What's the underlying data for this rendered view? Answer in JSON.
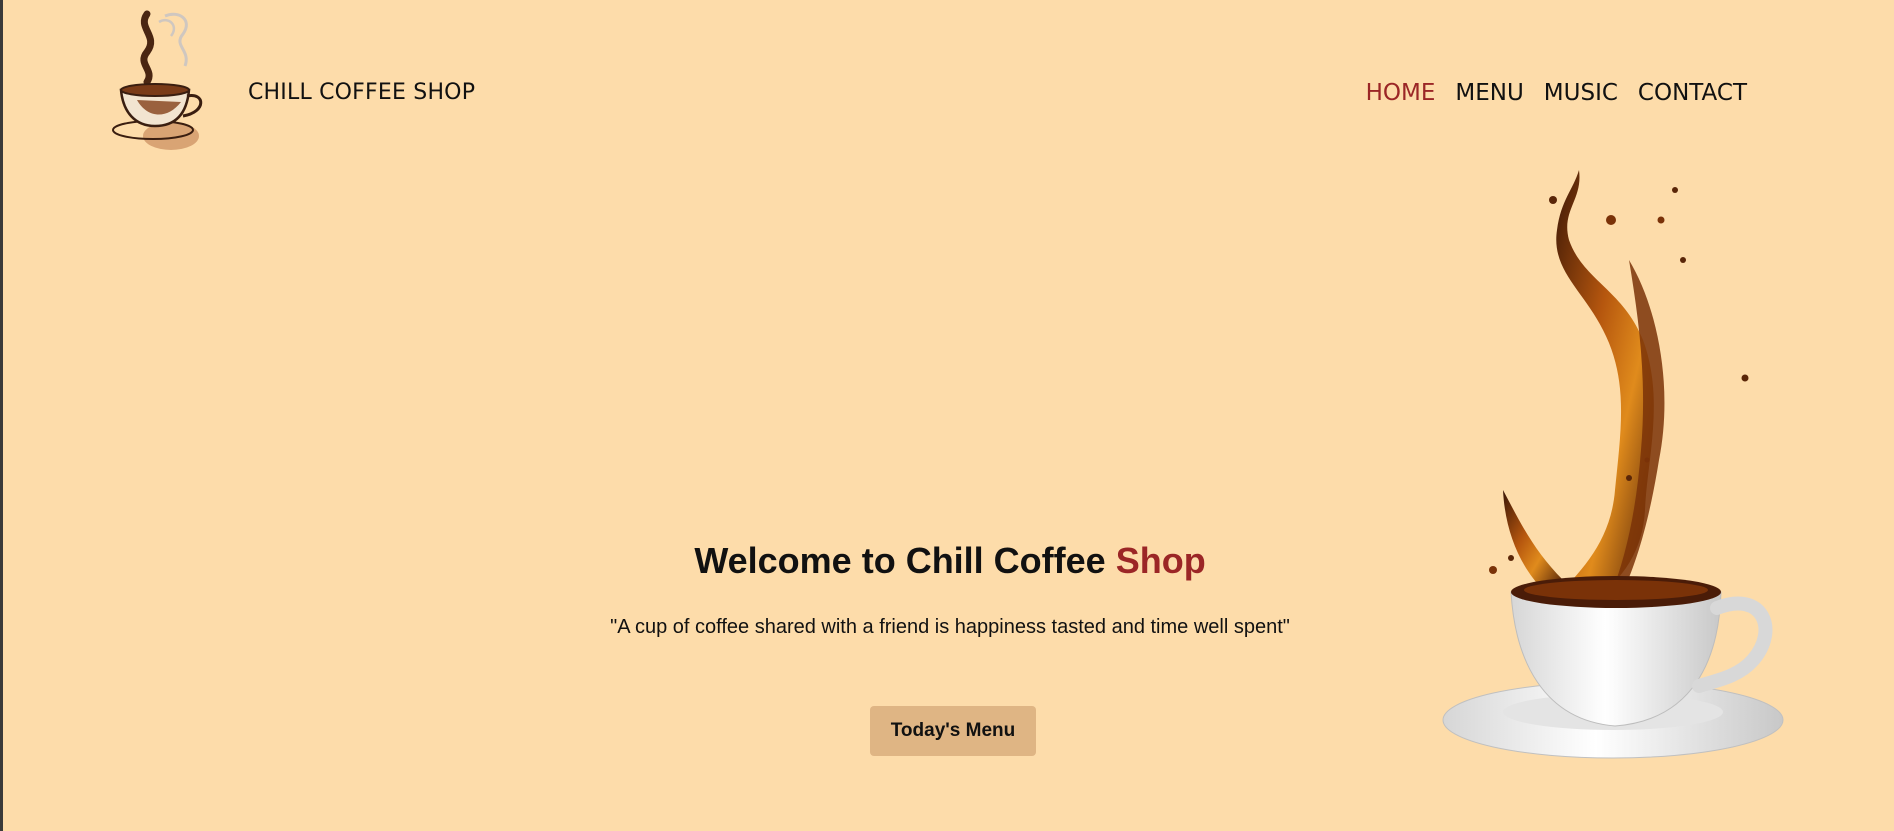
{
  "header": {
    "brand_name": "CHILL COFFEE SHOP",
    "logo_icon": "coffee-cup-steam-icon",
    "nav": [
      {
        "label": "HOME",
        "active": true
      },
      {
        "label": "MENU",
        "active": false
      },
      {
        "label": "MUSIC",
        "active": false
      },
      {
        "label": "CONTACT",
        "active": false
      }
    ]
  },
  "hero": {
    "title_main": "Welcome to Chill Coffee ",
    "title_accent": "Shop",
    "quote": "\"A cup of coffee shared with a friend is happiness tasted and time well spent\"",
    "cta_label": "Today's Menu",
    "illustration": "coffee-splash-cup-image"
  },
  "colors": {
    "background": "#fddcaa",
    "accent": "#9b2626",
    "button": "#dfb584",
    "text": "#111111"
  }
}
